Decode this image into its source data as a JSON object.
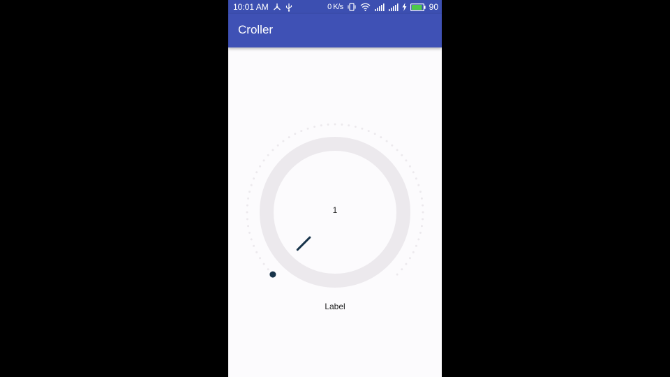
{
  "status_bar": {
    "time": "10:01 AM",
    "net_speed": "0 K/s",
    "battery_level": "90",
    "icons": [
      "usb-tether-icon",
      "usb-icon",
      "vibrate-icon",
      "wifi-icon",
      "signal-icon",
      "signal-icon",
      "charging-icon",
      "battery-icon"
    ]
  },
  "app_bar": {
    "title": "Croller"
  },
  "croller": {
    "value": "1",
    "label": "Label",
    "progress_fraction": 0.0,
    "colors": {
      "back_circle": "#ece9ed",
      "indicator": "#17334a",
      "progress_dots": "#ece9ed"
    }
  },
  "colors": {
    "primary": "#3f51b5",
    "status_bar": "#3c4fb1",
    "background": "#fcfbfd",
    "battery_fill": "#4cc84a"
  }
}
